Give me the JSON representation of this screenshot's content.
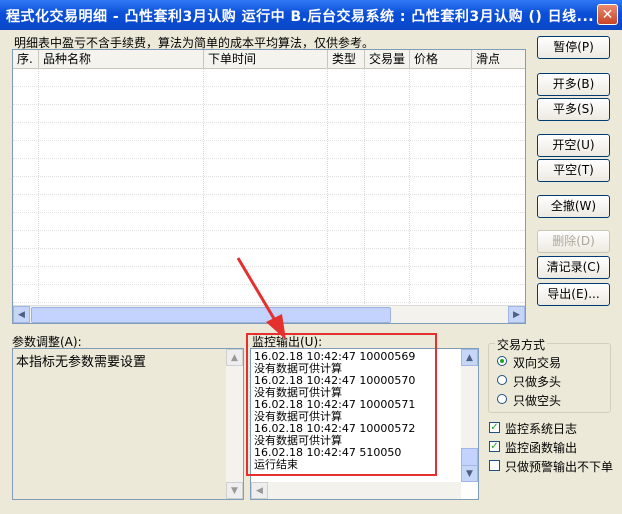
{
  "window": {
    "title": "程式化交易明细 - 凸性套利3月认购 运行中  B.后台交易系统 : 凸性套利3月认购 () 日线..."
  },
  "note": "明细表中盈亏不含手续费，算法为简单的成本平均算法，仅供参考。",
  "table": {
    "columns": [
      "序.",
      "品种名称",
      "下单时间",
      "类型",
      "交易量",
      "价格",
      "滑点"
    ],
    "rows": []
  },
  "buttons": {
    "pause": "暂停(P)",
    "open_long": "开多(B)",
    "close_long": "平多(S)",
    "open_short": "开空(U)",
    "close_short": "平空(T)",
    "cancel_all": "全撤(W)",
    "delete": "删除(D)",
    "clear_records": "清记录(C)",
    "export": "导出(E)..."
  },
  "params": {
    "label": "参数调整(A):",
    "text": "本指标无参数需要设置"
  },
  "monitor": {
    "label": "监控输出(U):",
    "lines": [
      "16.02.18 10:42:47  10000569",
      "没有数据可供计算",
      "16.02.18 10:42:47  10000570",
      "没有数据可供计算",
      "16.02.18 10:42:47  10000571",
      "没有数据可供计算",
      "16.02.18 10:42:47  10000572",
      "没有数据可供计算",
      "16.02.18 10:42:47  510050",
      "运行结束"
    ]
  },
  "trade_mode": {
    "title": "交易方式",
    "options": [
      "双向交易",
      "只做多头",
      "只做空头"
    ],
    "selected": "双向交易"
  },
  "checkboxes": [
    {
      "label": "监控系统日志",
      "checked": true
    },
    {
      "label": "监控函数输出",
      "checked": true
    },
    {
      "label": "只做预警输出不下单",
      "checked": false
    }
  ],
  "colors": {
    "annotation": "#e53030",
    "titlebar": "#0b4fd8"
  }
}
